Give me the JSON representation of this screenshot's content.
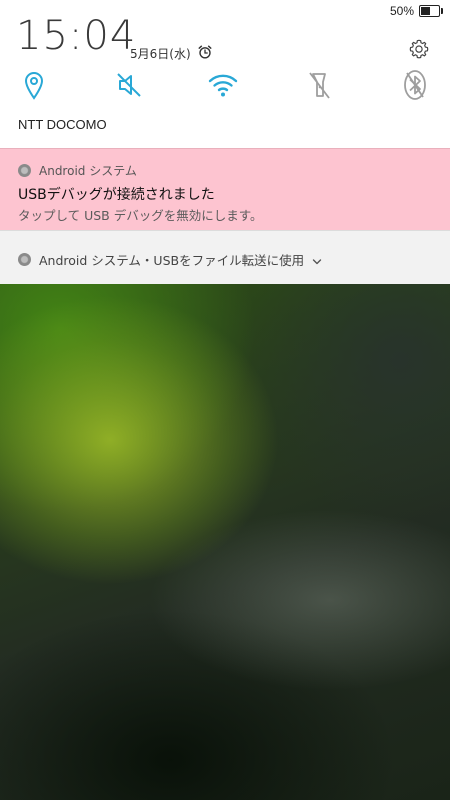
{
  "status_bar": {
    "battery_text": "50%",
    "battery_level": 0.5
  },
  "header": {
    "time": "15:04",
    "date": "5月6日(水)",
    "alarm_icon": "alarm-clock-icon",
    "settings_icon": "gear-icon"
  },
  "quick_settings": {
    "tiles": [
      {
        "name": "location",
        "icon": "location-pin-icon",
        "state": "on"
      },
      {
        "name": "sound",
        "icon": "muted-speaker-icon",
        "state": "on"
      },
      {
        "name": "wifi",
        "icon": "wifi-icon",
        "state": "on"
      },
      {
        "name": "flashlight",
        "icon": "flashlight-off-icon",
        "state": "off"
      },
      {
        "name": "bluetooth",
        "icon": "bluetooth-off-icon",
        "state": "off"
      }
    ],
    "active_color": "#29a8d6",
    "inactive_color": "#9e9e9e"
  },
  "carrier": "NTT DOCOMO",
  "notifications": {
    "usb_debug": {
      "app_name": "Android システム",
      "title": "USBデバッグが接続されました",
      "text": "タップして USB デバッグを無効にします。",
      "background": "#fdc4d0"
    },
    "usb_file": {
      "summary": "Android システム・USBをファイル転送に使用"
    }
  }
}
